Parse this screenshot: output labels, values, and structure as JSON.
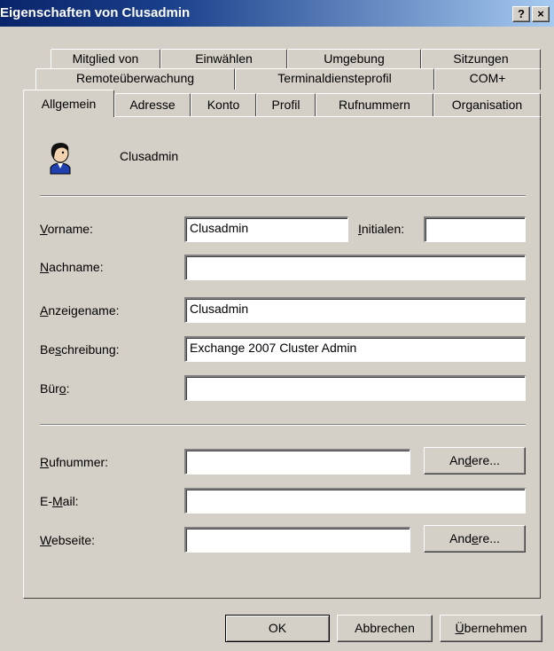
{
  "window": {
    "title": "Eigenschaften von Clusadmin",
    "help_btn": "?",
    "close_btn": "×"
  },
  "tabs": {
    "row1": [
      "Mitglied von",
      "Einwählen",
      "Umgebung",
      "Sitzungen"
    ],
    "row2": [
      "Remoteüberwachung",
      "Terminaldiensteprofil",
      "COM+"
    ],
    "row3": [
      "Allgemein",
      "Adresse",
      "Konto",
      "Profil",
      "Rufnummern",
      "Organisation"
    ],
    "active": "Allgemein"
  },
  "user": {
    "name": "Clusadmin",
    "icon": "user-icon"
  },
  "fields": {
    "vorname": {
      "pre": "",
      "key": "V",
      "post": "orname:",
      "value": "Clusadmin"
    },
    "initialen": {
      "pre": "",
      "key": "I",
      "post": "nitialen:",
      "value": ""
    },
    "nachname": {
      "pre": "",
      "key": "N",
      "post": "achname:",
      "value": ""
    },
    "anzeigename": {
      "pre": "",
      "key": "A",
      "post": "nzeigename:",
      "value": "Clusadmin"
    },
    "beschreibung": {
      "pre": "Be",
      "key": "s",
      "post": "chreibung:",
      "value": "Exchange 2007 Cluster Admin"
    },
    "buero": {
      "pre": "Bür",
      "key": "o",
      "post": ":",
      "value": ""
    },
    "rufnummer": {
      "pre": "",
      "key": "R",
      "post": "ufnummer:",
      "value": ""
    },
    "email": {
      "pre": "E-",
      "key": "M",
      "post": "ail:",
      "value": ""
    },
    "webseite": {
      "pre": "",
      "key": "W",
      "post": "ebseite:",
      "value": ""
    }
  },
  "buttons": {
    "andere1": {
      "pre": "An",
      "key": "d",
      "post": "ere..."
    },
    "andere2": {
      "pre": "And",
      "key": "e",
      "post": "re..."
    },
    "ok": "OK",
    "abbrechen": "Abbrechen",
    "uebernehmen": {
      "pre": "",
      "key": "Ü",
      "post": "bernehmen"
    }
  }
}
